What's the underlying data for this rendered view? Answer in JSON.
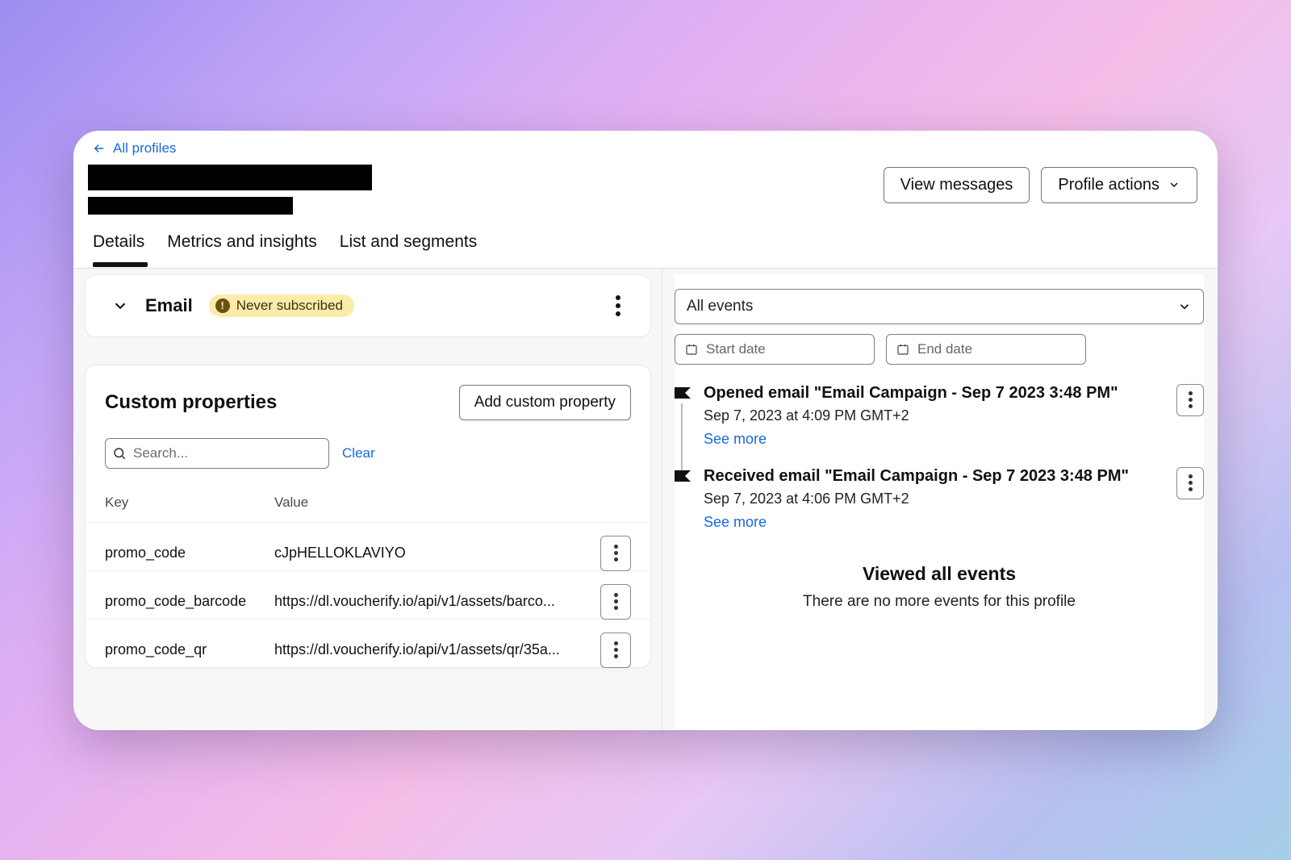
{
  "breadcrumb": {
    "label": "All profiles"
  },
  "actions": {
    "view_messages": "View messages",
    "profile_actions": "Profile actions"
  },
  "tabs": [
    {
      "label": "Details",
      "active": true
    },
    {
      "label": "Metrics and insights",
      "active": false
    },
    {
      "label": "List and segments",
      "active": false
    }
  ],
  "email_card": {
    "title": "Email",
    "badge": "Never subscribed"
  },
  "custom_properties": {
    "title": "Custom properties",
    "add_button": "Add custom property",
    "search_placeholder": "Search...",
    "clear_label": "Clear",
    "columns": {
      "key": "Key",
      "value": "Value"
    },
    "rows": [
      {
        "key": "promo_code",
        "value": "cJpHELLOKLAVIYO"
      },
      {
        "key": "promo_code_barcode",
        "value": "https://dl.voucherify.io/api/v1/assets/barco..."
      },
      {
        "key": "promo_code_qr",
        "value": "https://dl.voucherify.io/api/v1/assets/qr/35a..."
      }
    ]
  },
  "events_panel": {
    "filter_label": "All events",
    "start_placeholder": "Start date",
    "end_placeholder": "End date",
    "events": [
      {
        "title": "Opened email \"Email Campaign - Sep 7 2023 3:48 PM\"",
        "meta": "Sep 7, 2023 at 4:09 PM GMT+2",
        "see_more": "See more"
      },
      {
        "title": "Received email \"Email Campaign - Sep 7 2023 3:48 PM\"",
        "meta": "Sep 7, 2023 at 4:06 PM GMT+2",
        "see_more": "See more"
      }
    ],
    "footer_title": "Viewed all events",
    "footer_sub": "There are no more events for this profile"
  }
}
